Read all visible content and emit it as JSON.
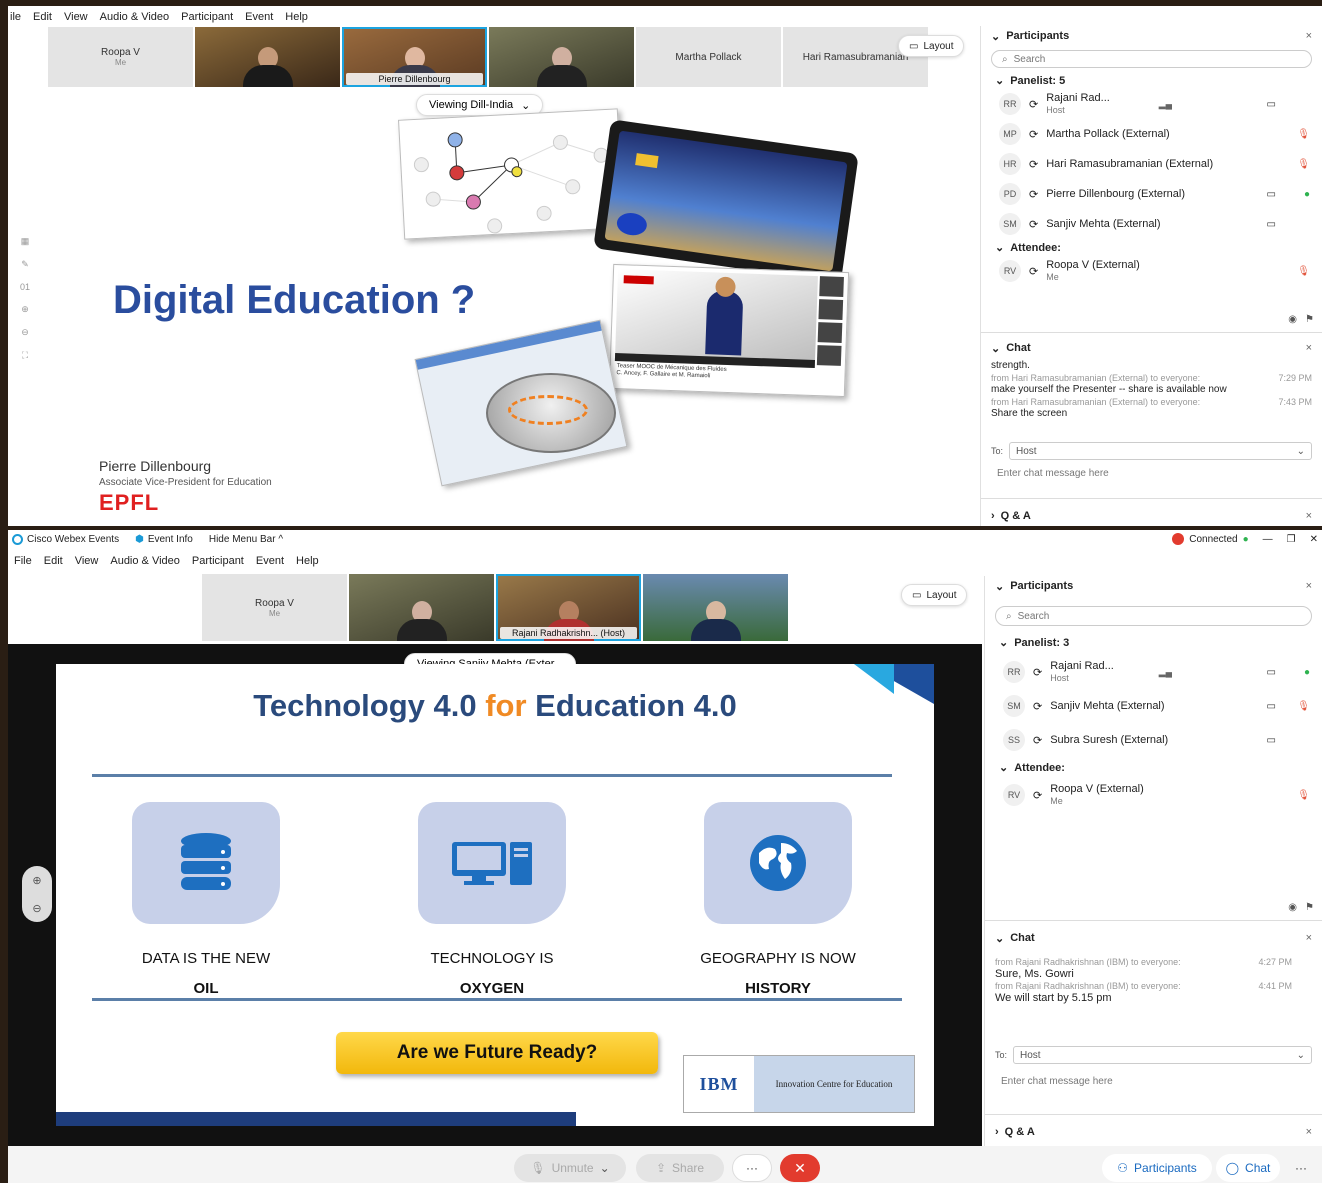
{
  "top": {
    "menu": [
      "ile",
      "Edit",
      "View",
      "Audio & Video",
      "Participant",
      "Event",
      "Help"
    ],
    "tiles": [
      {
        "name": "Roopa V",
        "me": "Me",
        "video": false
      },
      {
        "name": "",
        "video": true
      },
      {
        "name": "Pierre Dillenbourg",
        "video": true,
        "active": true
      },
      {
        "name": "",
        "video": true
      },
      {
        "name": "Martha Pollack",
        "video": false
      },
      {
        "name": "Hari Ramasubramanian",
        "video": false
      }
    ],
    "layout_label": "Layout",
    "viewing": "Viewing Dill-India",
    "side_tools": [
      "01"
    ],
    "slide": {
      "title": "Digital Education ?",
      "presenter": "Pierre Dillenbourg",
      "role": "Associate Vice-President for Education",
      "logo": "EPFL",
      "video_caption": "Teaser MOOC de Mécanique des Fluides",
      "video_caption2": "C. Ancey, F. Gallaire et M. Ramaioli"
    },
    "participants": {
      "title": "Participants",
      "search": "Search",
      "panelist_label": "Panelist: 5",
      "panelists": [
        {
          "initials": "RR",
          "name": "Rajani Rad...",
          "sub": "Host",
          "cam": true,
          "mic": ""
        },
        {
          "initials": "MP",
          "name": "Martha Pollack (External)",
          "sub": "",
          "cam": false,
          "mic": "red"
        },
        {
          "initials": "HR",
          "name": "Hari Ramasubramanian (External)",
          "sub": "",
          "cam": false,
          "mic": "red"
        },
        {
          "initials": "PD",
          "name": "Pierre Dillenbourg (External)",
          "sub": "",
          "cam": true,
          "mic": "green"
        },
        {
          "initials": "SM",
          "name": "Sanjiv Mehta (External)",
          "sub": "",
          "cam": true,
          "mic": ""
        }
      ],
      "attendee_label": "Attendee:",
      "attendees": [
        {
          "initials": "RV",
          "name": "Roopa V (External)",
          "sub": "Me",
          "mic": "red"
        }
      ]
    },
    "chat": {
      "title": "Chat",
      "messages": [
        {
          "from": "",
          "time": "",
          "text": "strength."
        },
        {
          "from": "from Hari Ramasubramanian (External) to everyone:",
          "time": "7:29 PM",
          "text": "make yourself the Presenter -- share is available now"
        },
        {
          "from": "from Hari Ramasubramanian (External) to everyone:",
          "time": "7:43 PM",
          "text": "Share the screen"
        }
      ],
      "to_label": "To:",
      "to_value": "Host",
      "placeholder": "Enter chat message here"
    },
    "qa_label": "Q & A"
  },
  "bottom": {
    "titlebar": {
      "app": "Cisco Webex Events",
      "event_info": "Event Info",
      "hide_menu": "Hide Menu Bar ^",
      "status": "Connected"
    },
    "menu": [
      "File",
      "Edit",
      "View",
      "Audio & Video",
      "Participant",
      "Event",
      "Help"
    ],
    "tiles": [
      {
        "name": "Roopa V",
        "me": "Me",
        "video": false
      },
      {
        "name": "",
        "video": true
      },
      {
        "name": "Rajani Radhakrishn... (Host)",
        "video": true,
        "active": true
      },
      {
        "name": "",
        "video": true
      }
    ],
    "layout_label": "Layout",
    "viewing": "Viewing Sanjiv Mehta (Exter...",
    "slide": {
      "title_a": "Technology 4.0 ",
      "title_b": "for",
      "title_c": " Education 4.0",
      "items": [
        {
          "line1": "DATA IS THE NEW",
          "line2": "OIL"
        },
        {
          "line1": "TECHNOLOGY IS",
          "line2": "OXYGEN"
        },
        {
          "line1": "GEOGRAPHY IS NOW",
          "line2": "HISTORY"
        }
      ],
      "cta": "Are we Future Ready?",
      "ibm": "IBM",
      "centre": "Innovation Centre for Education"
    },
    "participants": {
      "title": "Participants",
      "search": "Search",
      "panelist_label": "Panelist: 3",
      "panelists": [
        {
          "initials": "RR",
          "name": "Rajani Rad...",
          "sub": "Host",
          "cam": true,
          "mic": "green"
        },
        {
          "initials": "SM",
          "name": "Sanjiv Mehta (External)",
          "sub": "",
          "cam": true,
          "mic": "red"
        },
        {
          "initials": "SS",
          "name": "Subra Suresh (External)",
          "sub": "",
          "cam": true,
          "mic": ""
        }
      ],
      "attendee_label": "Attendee:",
      "attendees": [
        {
          "initials": "RV",
          "name": "Roopa V (External)",
          "sub": "Me",
          "mic": "red"
        }
      ]
    },
    "chat": {
      "title": "Chat",
      "messages": [
        {
          "from": "from Rajani Radhakrishnan (IBM) to everyone:",
          "time": "4:27 PM",
          "text": "Sure, Ms. Gowri"
        },
        {
          "from": "from Rajani Radhakrishnan (IBM) to everyone:",
          "time": "4:41 PM",
          "text": "We will start by 5.15 pm"
        }
      ],
      "to_label": "To:",
      "to_value": "Host",
      "placeholder": "Enter chat message here"
    },
    "qa_label": "Q & A",
    "controls": {
      "unmute": "Unmute",
      "share": "Share",
      "more": "···",
      "participants": "Participants",
      "chat": "Chat"
    }
  }
}
